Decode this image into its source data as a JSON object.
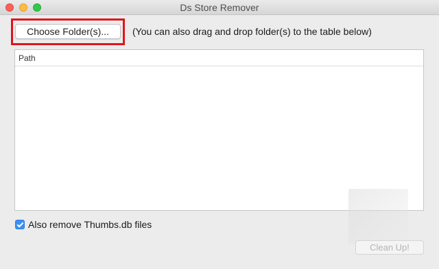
{
  "window": {
    "title": "Ds Store Remover"
  },
  "toolbar": {
    "choose_label": "Choose Folder(s)...",
    "hint": "(You can also drag and drop folder(s) to the table below)"
  },
  "table": {
    "columns": [
      "Path"
    ],
    "rows": []
  },
  "options": {
    "remove_thumbs_label": "Also remove Thumbs.db files",
    "remove_thumbs_checked": true
  },
  "actions": {
    "cleanup_label": "Clean Up!",
    "cleanup_enabled": false
  },
  "colors": {
    "highlight": "#e0141a",
    "checkbox_accent": "#3b8ff6"
  }
}
